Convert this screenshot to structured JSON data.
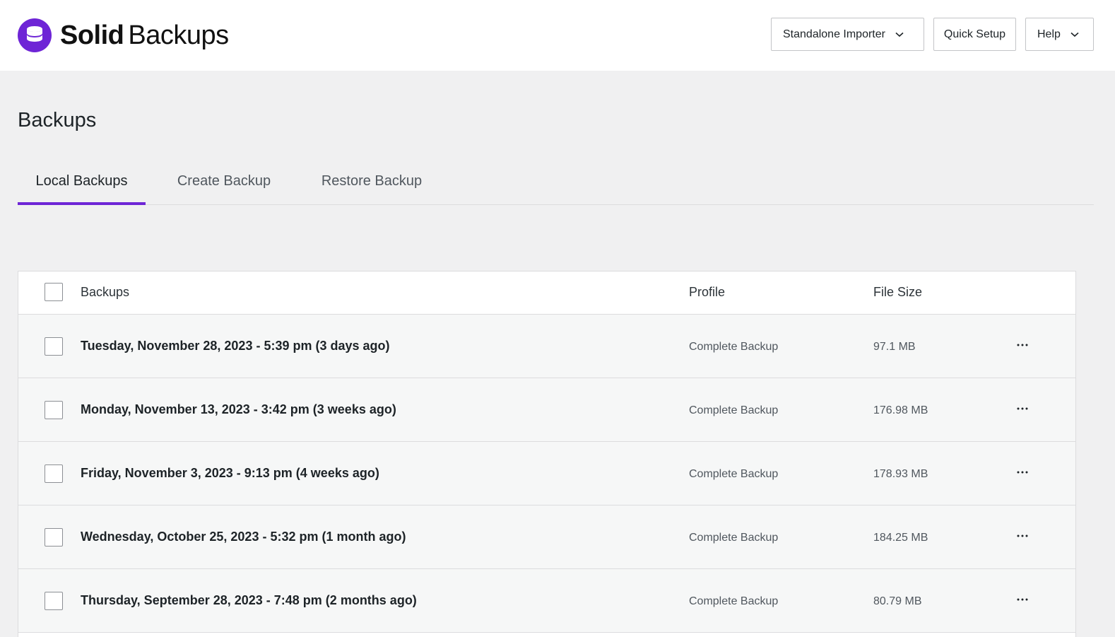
{
  "brand": {
    "name_bold": "Solid",
    "name_light": "Backups",
    "accent": "#6e25d6"
  },
  "header": {
    "importer_label": "Standalone Importer",
    "quick_setup_label": "Quick Setup",
    "help_label": "Help"
  },
  "page": {
    "title": "Backups"
  },
  "tabs": [
    {
      "label": "Local Backups",
      "active": true
    },
    {
      "label": "Create Backup",
      "active": false
    },
    {
      "label": "Restore Backup",
      "active": false
    }
  ],
  "table": {
    "columns": {
      "name": "Backups",
      "profile": "Profile",
      "size": "File Size"
    },
    "rows": [
      {
        "date": "Tuesday, November 28, 2023 - 5:39 pm (3 days ago)",
        "profile": "Complete Backup",
        "size": "97.1 MB"
      },
      {
        "date": "Monday, November 13, 2023 - 3:42 pm (3 weeks ago)",
        "profile": "Complete Backup",
        "size": "176.98 MB"
      },
      {
        "date": "Friday, November 3, 2023 - 9:13 pm (4 weeks ago)",
        "profile": "Complete Backup",
        "size": "178.93 MB"
      },
      {
        "date": "Wednesday, October 25, 2023 - 5:32 pm (1 month ago)",
        "profile": "Complete Backup",
        "size": "184.25 MB"
      },
      {
        "date": "Thursday, September 28, 2023 - 7:48 pm (2 months ago)",
        "profile": "Complete Backup",
        "size": "80.79 MB"
      }
    ]
  }
}
